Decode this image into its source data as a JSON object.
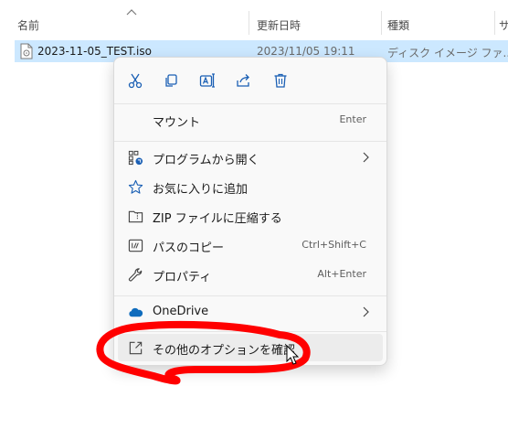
{
  "columns": {
    "name": "名前",
    "date": "更新日時",
    "type": "種類",
    "size": "サ"
  },
  "file": {
    "name": "2023-11-05_TEST.iso",
    "date": "2023/11/05 19:11",
    "type": "ディスク イメージ ファ..."
  },
  "context_menu": {
    "toolbar": [
      {
        "name": "cut-icon"
      },
      {
        "name": "copy-icon"
      },
      {
        "name": "rename-icon"
      },
      {
        "name": "share-icon"
      },
      {
        "name": "delete-icon"
      }
    ],
    "mount": {
      "label": "マウント",
      "shortcut": "Enter"
    },
    "open_with": {
      "label": "プログラムから開く"
    },
    "favorites": {
      "label": "お気に入りに追加"
    },
    "zip": {
      "label": "ZIP ファイルに圧縮する"
    },
    "copy_path": {
      "label": "パスのコピー",
      "shortcut": "Ctrl+Shift+C"
    },
    "properties": {
      "label": "プロパティ",
      "shortcut": "Alt+Enter"
    },
    "onedrive": {
      "label": "OneDrive"
    },
    "more_options": {
      "label": "その他のオプションを確認"
    }
  },
  "colors": {
    "selection": "#cce8ff",
    "menu_bg": "#f9f9f9",
    "onedrive_blue": "#0f6cbd",
    "icon_blue": "#1a5fb4",
    "annotation_red": "#ff0000"
  }
}
